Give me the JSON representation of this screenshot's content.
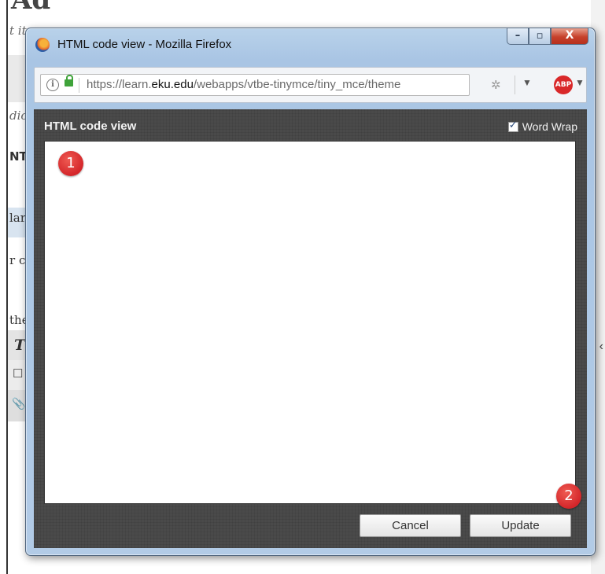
{
  "window": {
    "title": "HTML code view - Mozilla Firefox",
    "controls": {
      "minimize": "–",
      "maximize": "▫",
      "close": "X"
    }
  },
  "toolbar": {
    "url_prefix": "https://learn.",
    "url_domain": "eku.edu",
    "url_suffix": "/webapps/vtbe-tinymce/tiny_mce/theme",
    "info_icon": "i",
    "abp_label": "ABP"
  },
  "dialog": {
    "title": "HTML code view",
    "word_wrap_label": "Word Wrap",
    "word_wrap_checked": true,
    "code_value": "",
    "cancel_label": "Cancel",
    "update_label": "Update"
  },
  "markers": {
    "first": "1",
    "second": "2"
  },
  "background": {
    "top_text": "Ad",
    "italic_line": "t ite",
    "italic_line2": "dic",
    "bold_fragment": "NT",
    "line_lar": "lar",
    "line_r": "r c",
    "line_the": "the",
    "toolbar_glyph": "T",
    "box_glyph": "☐",
    "clip_glyph": "📎"
  },
  "colors": {
    "window_frame": "#a9c5e4",
    "dialog_bg": "#4a4a4a",
    "marker_red": "#d4262a",
    "close_red": "#c6412b"
  }
}
